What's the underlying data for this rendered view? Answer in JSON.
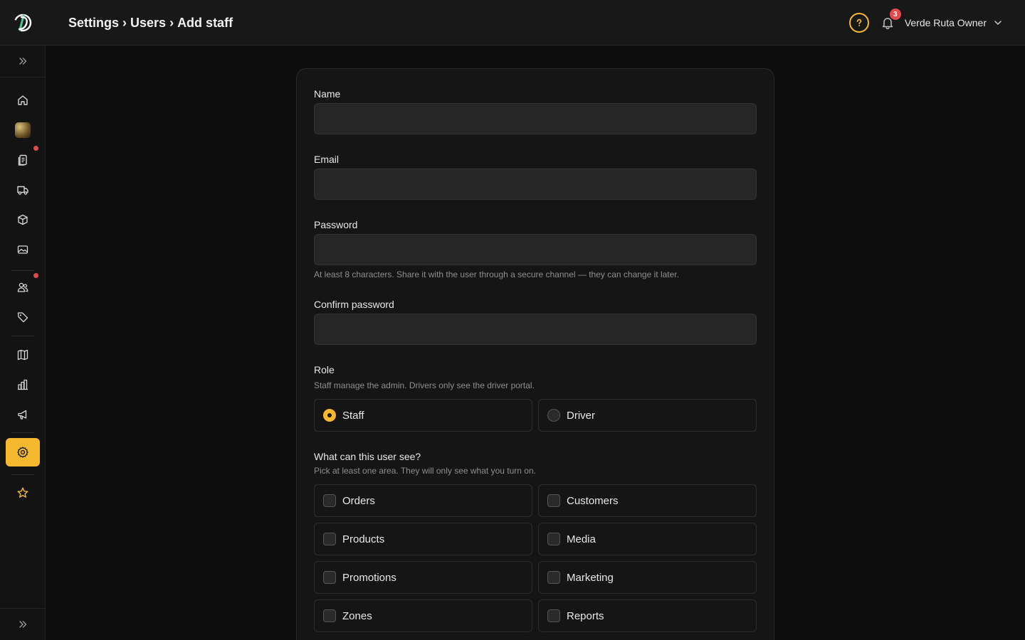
{
  "header": {
    "breadcrumb": [
      "Settings",
      "Users",
      "Add staff"
    ],
    "separator": "›",
    "notification_count": "3",
    "user_name": "Verde Ruta Owner"
  },
  "theme": {
    "accent": "#f5b82e",
    "badge": "#e5484d"
  },
  "sidebar": {
    "items": [
      {
        "icon": "home-icon"
      },
      {
        "icon": "store-avatar"
      },
      {
        "icon": "orders-icon",
        "dot": true
      },
      {
        "icon": "truck-icon"
      },
      {
        "icon": "box-icon"
      },
      {
        "icon": "media-icon"
      },
      {
        "icon": "users-icon",
        "dot": true
      },
      {
        "icon": "tag-icon"
      },
      {
        "icon": "map-icon"
      },
      {
        "icon": "chart-icon"
      },
      {
        "icon": "megaphone-icon"
      },
      {
        "icon": "settings-icon",
        "active": true
      },
      {
        "icon": "star-icon"
      }
    ]
  },
  "form": {
    "name_label": "Name",
    "name_value": "",
    "email_label": "Email",
    "email_value": "",
    "password_label": "Password",
    "password_value": "",
    "password_hint": "At least 8 characters. Share it with the user through a secure channel — they can change it later.",
    "confirm_label": "Confirm password",
    "confirm_value": "",
    "role_label": "Role",
    "role_hint": "Staff manage the admin. Drivers only see the driver portal.",
    "role_options": [
      {
        "label": "Staff",
        "selected": true
      },
      {
        "label": "Driver",
        "selected": false
      }
    ],
    "access_label": "What can this user see?",
    "access_hint": "Pick at least one area. They will only see what you turn on.",
    "access_options": [
      {
        "label": "Orders",
        "checked": false
      },
      {
        "label": "Customers",
        "checked": false
      },
      {
        "label": "Products",
        "checked": false
      },
      {
        "label": "Media",
        "checked": false
      },
      {
        "label": "Promotions",
        "checked": false
      },
      {
        "label": "Marketing",
        "checked": false
      },
      {
        "label": "Zones",
        "checked": false
      },
      {
        "label": "Reports",
        "checked": false
      }
    ]
  }
}
